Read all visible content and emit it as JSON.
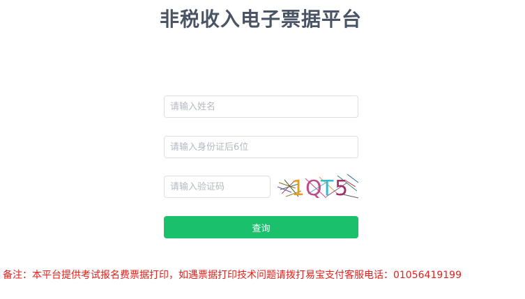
{
  "header": {
    "title": "非税收入电子票据平台"
  },
  "form": {
    "name_placeholder": "请输入姓名",
    "id_placeholder": "请输入身份证后6位",
    "captcha_placeholder": "请输入验证码",
    "captcha_text": "1QT5",
    "submit_label": "查询"
  },
  "footer": {
    "remark": "备注：本平台提供考试报名费票据打印，如遇票据打印技术问题请拨打易宝支付客服电话：01056419199"
  },
  "colors": {
    "title": "#4a5465",
    "button": "#1ac06c",
    "remark": "#e0201a",
    "input_border": "#dcdfe6"
  }
}
